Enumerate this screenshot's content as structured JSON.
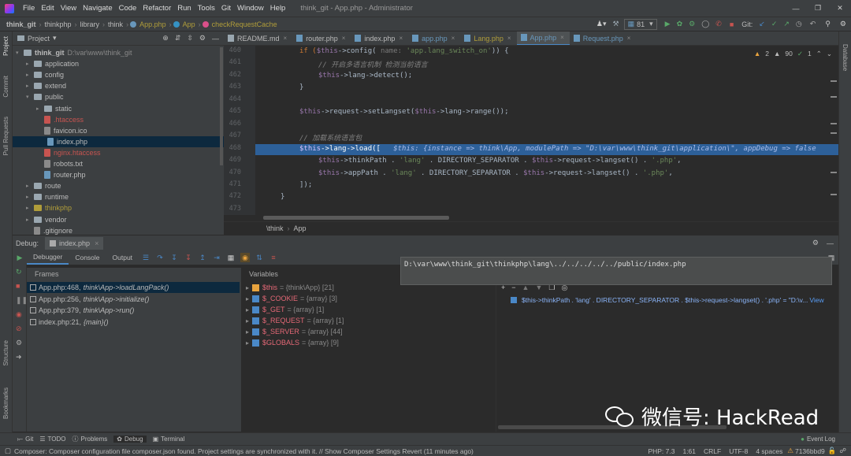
{
  "menu": [
    "File",
    "Edit",
    "View",
    "Navigate",
    "Code",
    "Refactor",
    "Run",
    "Tools",
    "Git",
    "Window",
    "Help"
  ],
  "window_title": "think_git - App.php - Administrator",
  "breadcrumbs": [
    "think_git",
    "thinkphp",
    "library",
    "think",
    "App.php",
    "App",
    "checkRequestCache"
  ],
  "run_config": "81",
  "git_label": "Git:",
  "project_header": "Project",
  "tree": [
    {
      "label": "think_git",
      "path": "D:\\var\\www\\think_git",
      "depth": 0,
      "type": "folder",
      "open": true
    },
    {
      "label": "application",
      "depth": 1,
      "type": "folder"
    },
    {
      "label": "config",
      "depth": 1,
      "type": "folder"
    },
    {
      "label": "extend",
      "depth": 1,
      "type": "folder"
    },
    {
      "label": "public",
      "depth": 1,
      "type": "folder",
      "open": true
    },
    {
      "label": "static",
      "depth": 2,
      "type": "folder"
    },
    {
      "label": ".htaccess",
      "depth": 2,
      "type": "file",
      "color": "#c75450"
    },
    {
      "label": "favicon.ico",
      "depth": 2,
      "type": "file"
    },
    {
      "label": "index.php",
      "depth": 2,
      "type": "file",
      "selected": true
    },
    {
      "label": "nginx.htaccess",
      "depth": 2,
      "type": "file",
      "color": "#c75450"
    },
    {
      "label": "robots.txt",
      "depth": 2,
      "type": "file"
    },
    {
      "label": "router.php",
      "depth": 2,
      "type": "file"
    },
    {
      "label": "route",
      "depth": 1,
      "type": "folder"
    },
    {
      "label": "runtime",
      "depth": 1,
      "type": "folder"
    },
    {
      "label": "thinkphp",
      "depth": 1,
      "type": "folder",
      "color": "#b09d3a"
    },
    {
      "label": "vendor",
      "depth": 1,
      "type": "folder"
    },
    {
      "label": ".gitignore",
      "depth": 1,
      "type": "file"
    }
  ],
  "tabs": [
    {
      "label": "README.md",
      "color": "#bbbbbb"
    },
    {
      "label": "router.php",
      "color": "#bbbbbb"
    },
    {
      "label": "index.php",
      "color": "#bbbbbb"
    },
    {
      "label": "app.php",
      "color": "#6897bb"
    },
    {
      "label": "Lang.php",
      "color": "#b09d3a"
    },
    {
      "label": "App.php",
      "color": "#6897bb",
      "active": true
    },
    {
      "label": "Request.php",
      "color": "#6897bb"
    }
  ],
  "inspections": {
    "warnings": "2",
    "weak": "90",
    "typos": "1"
  },
  "line_numbers": [
    "460",
    "461",
    "462",
    "463",
    "464",
    "465",
    "466",
    "467",
    "468",
    "469",
    "470",
    "471",
    "472",
    "473",
    "474"
  ],
  "code": {
    "l460_a": "if (",
    "l460_b": "$this",
    "l460_c": "->config( ",
    "l460_hint": "name: ",
    "l460_str": "'app.lang_switch_on'",
    "l460_d": ")) {",
    "l461": "// 开启多语言机制 检测当前语言",
    "l462_a": "$this",
    "l462_b": "->lang->detect();",
    "l463": "}",
    "l465_a": "$this",
    "l465_b": "->request->setLangset(",
    "l465_c": "$this",
    "l465_d": "->lang->range());",
    "l467": "// 加载系统语言包",
    "l468_a": "$this",
    "l468_b": "->lang->load([",
    "l468_dbg": "   $this: {instance => think\\App, modulePath => \"D:\\var\\www\\think_git\\application\\\", appDebug => false",
    "l469_a": "$this",
    "l469_b": "->thinkPath . ",
    "l469_s1": "'lang'",
    "l469_c": " . DIRECTORY_SEPARATOR . ",
    "l469_d": "$this",
    "l469_e": "->request->langset() . ",
    "l469_s2": "'.php'",
    "l469_f": ",",
    "l470_a": "$this",
    "l470_b": "->appPath . ",
    "l470_s1": "'lang'",
    "l470_c": " . DIRECTORY_SEPARATOR . ",
    "l470_d": "$this",
    "l470_e": "->request->langset() . ",
    "l470_s2": "'.php'",
    "l470_f": ",",
    "l471": "]);",
    "l472": "}"
  },
  "editor_breadcrumb": [
    "\\think",
    "App"
  ],
  "debug_label": "Debug:",
  "debug_session": "index.php",
  "debug_tabs": [
    "Debugger",
    "Console",
    "Output"
  ],
  "frames_header": "Frames",
  "frames": [
    {
      "file": "App.php:468,",
      "call": "think\\App->loadLangPack()",
      "selected": true
    },
    {
      "file": "App.php:256,",
      "call": "think\\App->initialize()"
    },
    {
      "file": "App.php:379,",
      "call": "think\\App->run()"
    },
    {
      "file": "index.php:21,",
      "call": "{main}()"
    }
  ],
  "variables_header": "Variables",
  "variables": [
    {
      "name": "$this",
      "value": "= {think\\App} [21]"
    },
    {
      "name": "$_COOKIE",
      "value": "= {array} [3]"
    },
    {
      "name": "$_GET",
      "value": "= {array} [1]"
    },
    {
      "name": "$_REQUEST",
      "value": "= {array} [1]"
    },
    {
      "name": "$_SERVER",
      "value": "= {array} [44]"
    },
    {
      "name": "$GLOBALS",
      "value": "= {array} [9]"
    }
  ],
  "tooltip_text": "D:\\var\\www\\think_git\\thinkphp\\lang\\../../../../../public/index.php",
  "watch_expr": "$this->thinkPath . 'lang' . DIRECTORY_SEPARATOR . $this->request->langset() . '.php' = \"D:\\v...",
  "watch_view": "View",
  "bottom_tabs": [
    "Git",
    "TODO",
    "Problems",
    "Debug",
    "Terminal"
  ],
  "event_log": "Event Log",
  "status_message": "Composer: Composer configuration file composer.json found. Project settings are synchronized with it. // Show Composer Settings   Revert (11 minutes ago)",
  "status_right": [
    "PHP: 7.3",
    "1:61",
    "CRLF",
    "UTF-8",
    "4 spaces",
    "7136bbd9"
  ],
  "side_left": [
    "Project",
    "Commit",
    "Pull Requests",
    "Structure",
    "Bookmarks"
  ],
  "side_right": "Database",
  "watermark": "微信号: HackRead"
}
